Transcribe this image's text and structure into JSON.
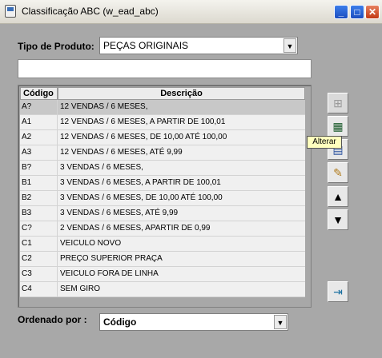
{
  "window": {
    "title": "Classificação ABC (w_ead_abc)"
  },
  "filter": {
    "label": "Tipo de Produto:",
    "value": "PEÇAS ORIGINAIS"
  },
  "grid": {
    "headers": {
      "code": "Código",
      "desc": "Descrição"
    },
    "rows": [
      {
        "code": "A?",
        "desc": "12 VENDAS / 6 MESES,"
      },
      {
        "code": "A1",
        "desc": "12 VENDAS / 6 MESES, A PARTIR DE 100,01"
      },
      {
        "code": "A2",
        "desc": "12 VENDAS / 6 MESES, DE 10,00 ATÉ 100,00"
      },
      {
        "code": "A3",
        "desc": "12 VENDAS / 6 MESES,  ATÉ 9,99"
      },
      {
        "code": "B?",
        "desc": "3 VENDAS / 6 MESES,"
      },
      {
        "code": "B1",
        "desc": "3 VENDAS / 6 MESES, A PARTIR DE 100,01"
      },
      {
        "code": "B2",
        "desc": "3 VENDAS / 6 MESES, DE 10,00 ATÉ 100,00"
      },
      {
        "code": "B3",
        "desc": "3 VENDAS / 6 MESES,  ATÉ 9,99"
      },
      {
        "code": "C?",
        "desc": "2 VENDAS / 6 MESES, APARTIR DE 0,99"
      },
      {
        "code": "C1",
        "desc": "VEICULO NOVO"
      },
      {
        "code": "C2",
        "desc": "PREÇO SUPERIOR PRAÇA"
      },
      {
        "code": "C3",
        "desc": "VEICULO  FORA  DE LINHA"
      },
      {
        "code": "C4",
        "desc": "SEM GIRO"
      }
    ]
  },
  "tooltip": {
    "text": "Alterar"
  },
  "sort": {
    "label": "Ordenado por :",
    "value": "Código"
  }
}
